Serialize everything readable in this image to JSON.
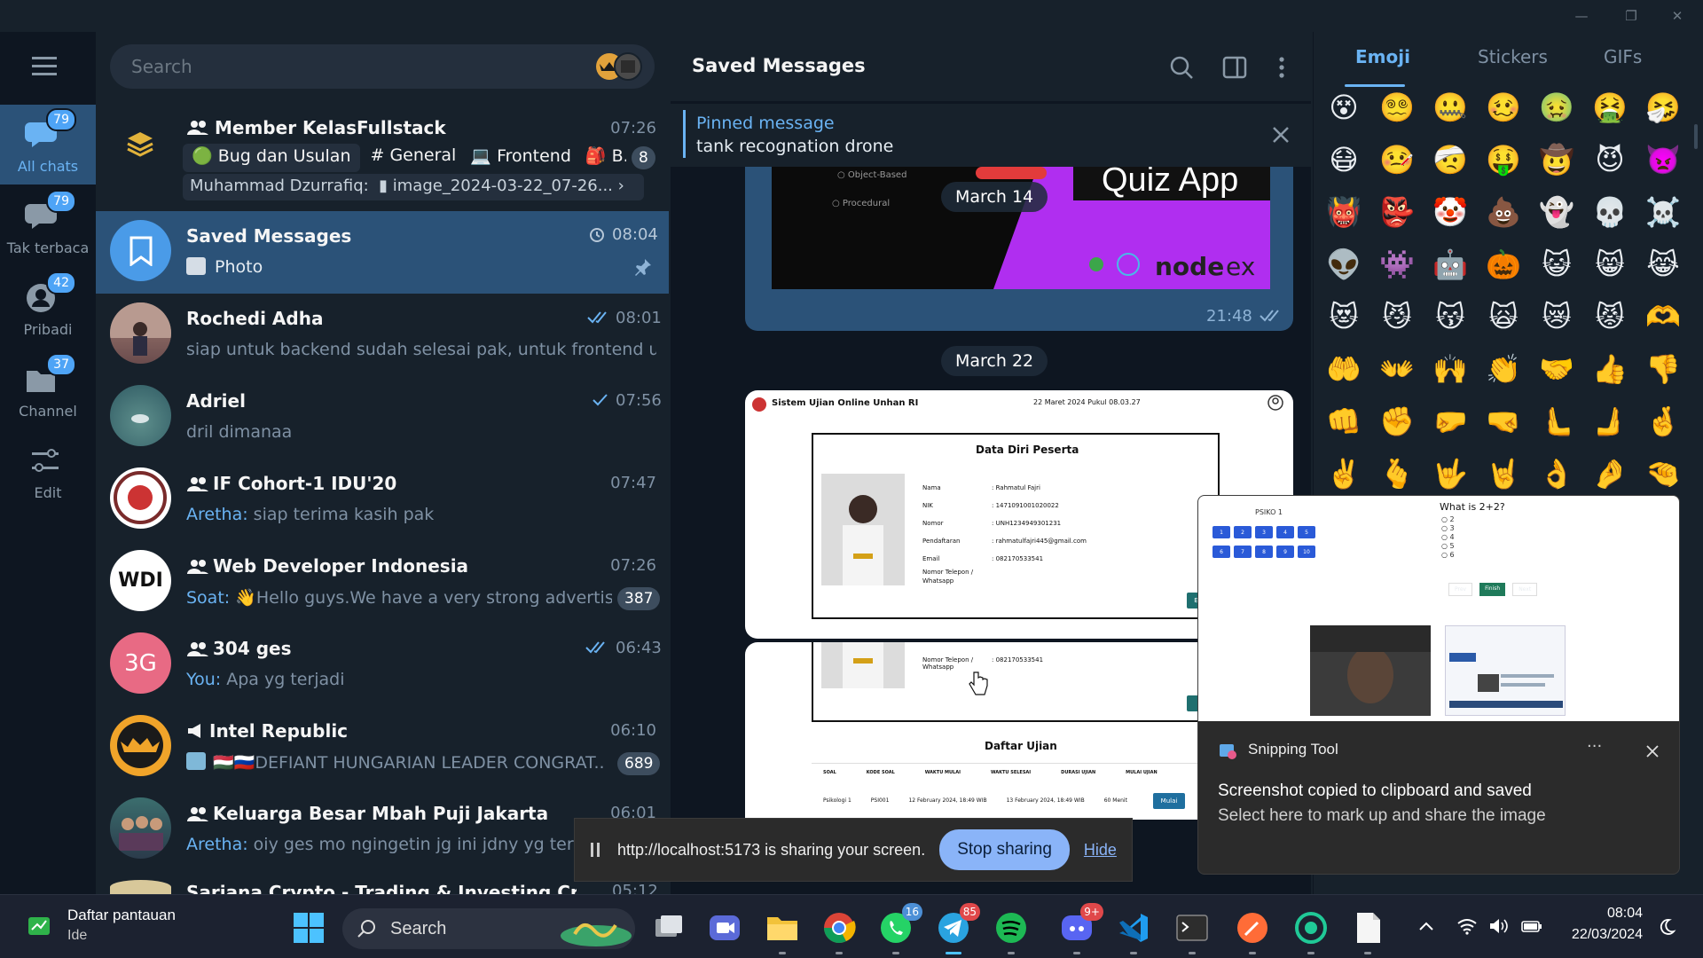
{
  "window": {
    "minimize": "—",
    "restore": "❐",
    "close": "✕"
  },
  "rail": {
    "folders": [
      {
        "label": "All chats",
        "badge": "79"
      },
      {
        "label": "Tak terbaca",
        "badge": "79"
      },
      {
        "label": "Pribadi",
        "badge": "42"
      },
      {
        "label": "Channel",
        "badge": "37"
      },
      {
        "label": "Edit"
      }
    ]
  },
  "search": {
    "placeholder": "Search"
  },
  "chats": [
    {
      "name": "Member KelasFullstack",
      "time": "07:26",
      "topics": [
        "Bug dan Usulan",
        "# General",
        "Frontend",
        "B..."
      ],
      "topic_icons": [
        "🟢",
        "",
        "💻",
        "🎒"
      ],
      "sender": "Muhammad Dzurrafiq:",
      "message": "image_2024-03-22_07-26...",
      "badge": "8"
    },
    {
      "name": "Saved Messages",
      "time": "08:04",
      "message": "Photo"
    },
    {
      "name": "Rochedi Adha",
      "time": "08:01",
      "message": "siap untuk backend sudah selesai pak, untuk frontend uj..."
    },
    {
      "name": "Adriel",
      "time": "07:56",
      "message": "dril dimanaa"
    },
    {
      "name": "IF Cohort-1 IDU'20",
      "time": "07:47",
      "sender": "Aretha:",
      "message": "siap terima kasih pak"
    },
    {
      "name": "Web Developer Indonesia",
      "time": "07:26",
      "sender": "Soat:",
      "message": "👋Hello guys.We have a very strong advertisi...",
      "badge": "387",
      "avatar_text": "WDI"
    },
    {
      "name": "304 ges",
      "time": "06:43",
      "sender": "You:",
      "message": "Apa yg terjadi",
      "avatar_text": "3G"
    },
    {
      "name": "Intel Republic",
      "time": "06:10",
      "message": "🇭🇺🇷🇺DEFIANT HUNGARIAN LEADER CONGRAT...",
      "badge": "689"
    },
    {
      "name": "Keluarga Besar Mbah Puji Jakarta",
      "time": "06:01",
      "sender": "Aretha:",
      "message": "oiy ges mo ngingetin jg ini jdny yg terban"
    },
    {
      "name": "Sarjana Crypto - Trading & Investing Cryptocurr...",
      "time": "05:12"
    }
  ],
  "chat_header": {
    "title": "Saved Messages"
  },
  "pinned": {
    "label": "Pinned message",
    "text": "tank recognation drone"
  },
  "messages": {
    "quiz_title": "Quiz App",
    "quiz_options": [
      "Object-Based",
      "Procedural"
    ],
    "node_text": "node",
    "ex_text": "ex",
    "date1": "March 14",
    "time1": "21:48",
    "date2": "March 22",
    "exam_header": "Sistem Ujian Online Unhan RI",
    "exam_date": "22 Maret 2024 Pukul 08.03.27",
    "profile_title": "Data Diri Peserta",
    "fields": [
      {
        "k": "Nama",
        "v": ": Rahmatul Fajri"
      },
      {
        "k": "NIK",
        "v": ": 1471091001020022"
      },
      {
        "k": "Nomor Pendaftaran",
        "v": ": UNH1234949301231"
      },
      {
        "k": "Email",
        "v": ": rahmatulfajri445@gmail.com"
      },
      {
        "k": "Nomor Telepon / Whatsapp",
        "v": ": 082170533541"
      }
    ],
    "exam_list_title": "Daftar Ujian",
    "exam_cols": [
      "SOAL",
      "KODE SOAL",
      "WAKTU MULAI",
      "WAKTU SELESAI",
      "DURASI UJIAN",
      "MULAI UJIAN"
    ],
    "exam_row": [
      "Psikologi 1",
      "PSI001",
      "12 February 2024, 18:49 WIB",
      "13 February 2024, 18:49 WIB",
      "60 Menit",
      "Mulai"
    ],
    "edit_label": "Edit"
  },
  "emoji_panel": {
    "tabs": [
      "Emoji",
      "Stickers",
      "GIFs"
    ],
    "emojis": [
      "😵",
      "😵‍💫",
      "🤐",
      "🥴",
      "🤢",
      "🤮",
      "🤧",
      "😷",
      "🤒",
      "🤕",
      "🤑",
      "🤠",
      "😈",
      "👿",
      "👹",
      "👺",
      "🤡",
      "💩",
      "👻",
      "💀",
      "☠️",
      "👽",
      "👾",
      "🤖",
      "🎃",
      "😺",
      "😸",
      "😹",
      "😻",
      "😼",
      "😽",
      "🙀",
      "😿",
      "😾",
      "🫶",
      "🤲",
      "👐",
      "🙌",
      "👏",
      "🤝",
      "👍",
      "👎",
      "👊",
      "✊",
      "🤛",
      "🤜",
      "🫷",
      "🫸",
      "🤞",
      "✌️",
      "🫰",
      "🤟",
      "🤘",
      "👌",
      "🤌",
      "🤏"
    ]
  },
  "screen_share": {
    "text": "http://localhost:5173 is sharing your screen.",
    "stop": "Stop sharing",
    "hide": "Hide"
  },
  "toast": {
    "app": "Snipping Tool",
    "more": "···",
    "title": "Screenshot copied to clipboard and saved",
    "body": "Select here to mark up and share the image",
    "preview_question": "What is 2+2?",
    "preview_options": [
      "2",
      "3",
      "4",
      "5",
      "6"
    ],
    "preview_label": "PSIKO 1",
    "preview_buttons": [
      "Prev",
      "Finish",
      "Next"
    ],
    "preview_grid": [
      "1",
      "2",
      "3",
      "4",
      "5",
      "6",
      "7",
      "8",
      "9",
      "10"
    ]
  },
  "taskbar": {
    "widget_title": "Daftar pantauan",
    "widget_sub": "Ide",
    "search": "Search",
    "badges": {
      "whatsapp": "16",
      "telegram": "85",
      "discord": "9+"
    },
    "time": "08:04",
    "date": "22/03/2024"
  },
  "colors": {
    "accent": "#6ab3f3",
    "selected": "#2b5278",
    "stop_button": "#6ea8ff",
    "avatar_3g": "#e86a84"
  }
}
